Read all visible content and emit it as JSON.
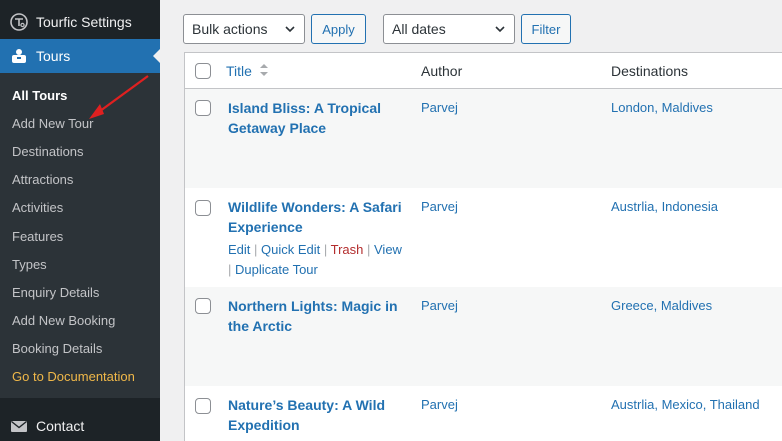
{
  "sidebar": {
    "settings_label": "Tourfic Settings",
    "tours_label": "Tours",
    "contact_label": "Contact",
    "submenu": [
      {
        "label": "All Tours"
      },
      {
        "label": "Add New Tour"
      },
      {
        "label": "Destinations"
      },
      {
        "label": "Attractions"
      },
      {
        "label": "Activities"
      },
      {
        "label": "Features"
      },
      {
        "label": "Types"
      },
      {
        "label": "Enquiry Details"
      },
      {
        "label": "Add New Booking"
      },
      {
        "label": "Booking Details"
      },
      {
        "label": "Go to Documentation"
      }
    ]
  },
  "toolbar": {
    "bulk_actions": "Bulk actions",
    "apply": "Apply",
    "dates": "All dates",
    "filter": "Filter"
  },
  "table": {
    "columns": {
      "title": "Title",
      "author": "Author",
      "destinations": "Destinations"
    },
    "rows": [
      {
        "title": "Island Bliss: A Tropical Getaway Place",
        "author": "Parvej",
        "destinations": "London, Maldives"
      },
      {
        "title": "Wildlife Wonders: A Safari Experience",
        "author": "Parvej",
        "destinations": "Austrlia, Indonesia"
      },
      {
        "title": "Northern Lights: Magic in the Arctic",
        "author": "Parvej",
        "destinations": "Greece, Maldives"
      },
      {
        "title": "Nature’s Beauty: A Wild Expedition",
        "author": "Parvej",
        "destinations": "Austrlia, Mexico, Thailand"
      }
    ],
    "row_actions": {
      "edit": "Edit",
      "quick_edit": "Quick Edit",
      "trash": "Trash",
      "view": "View",
      "duplicate": "Duplicate Tour"
    }
  },
  "colors": {
    "accent": "#2271b1",
    "sidebar_bg": "#1d2327",
    "submenu_bg": "#2c3338",
    "doc_link": "#f0b849",
    "trash": "#b32d2e",
    "annotation_arrow": "#e02020"
  }
}
